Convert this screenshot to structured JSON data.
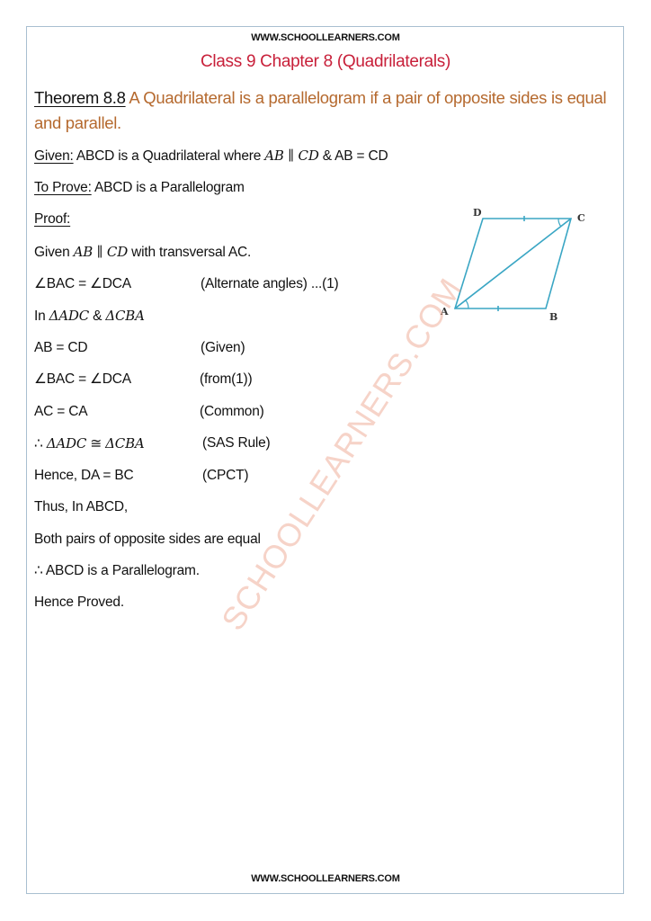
{
  "header": {
    "site_url": "WWW.SCHOOLLEARNERS.COM",
    "chapter_title": "Class 9 Chapter 8 (Quadrilaterals)"
  },
  "theorem": {
    "label": "Theorem 8.8",
    "statement": " A Quadrilateral is a parallelogram if a pair of opposite sides is equal and parallel."
  },
  "given": {
    "label": "Given:",
    "text_before": " ABCD is a Quadrilateral where ",
    "math": "AB ∥ CD",
    "text_after": " & AB = CD"
  },
  "to_prove": {
    "label": "To Prove:",
    "text": " ABCD is a Parallelogram"
  },
  "proof": {
    "label": "Proof:",
    "given_line": {
      "before": "Given ",
      "math": "AB ∥ CD",
      "after": " with transversal AC."
    },
    "steps": [
      {
        "statement": "∠BAC = ∠DCA",
        "reason": "(Alternate angles)   ...(1)"
      },
      {
        "statement_prefix": "In ",
        "math1": "ΔADC",
        "mid": " & ",
        "math2": "ΔCBA",
        "reason": ""
      },
      {
        "statement": "AB = CD",
        "reason": "(Given)"
      },
      {
        "statement": "∠BAC = ∠DCA",
        "reason": "(from(1))"
      },
      {
        "statement": "AC = CA",
        "reason": "(Common)"
      },
      {
        "statement_prefix": "∴ ",
        "math1": "ΔADC",
        "mid": " ≅ ",
        "math2": "ΔCBA",
        "reason": "(SAS Rule)"
      },
      {
        "statement": "Hence, DA = BC",
        "reason": "(CPCT)"
      },
      {
        "statement": "Thus, In ABCD,",
        "reason": ""
      },
      {
        "statement": "Both pairs of opposite sides are equal",
        "reason": ""
      },
      {
        "statement": "∴ ABCD is a Parallelogram.",
        "reason": ""
      },
      {
        "statement": "Hence Proved.",
        "reason": ""
      }
    ]
  },
  "diagram": {
    "vertices": [
      "A",
      "B",
      "C",
      "D"
    ],
    "stroke_color": "#3aa6c4"
  },
  "footer": {
    "site_url": "WWW.SCHOOLLEARNERS.COM"
  },
  "watermark": "SCHOOLLEARNERS.COM",
  "colors": {
    "title": "#c8203a",
    "theorem_statement": "#b5692e"
  }
}
